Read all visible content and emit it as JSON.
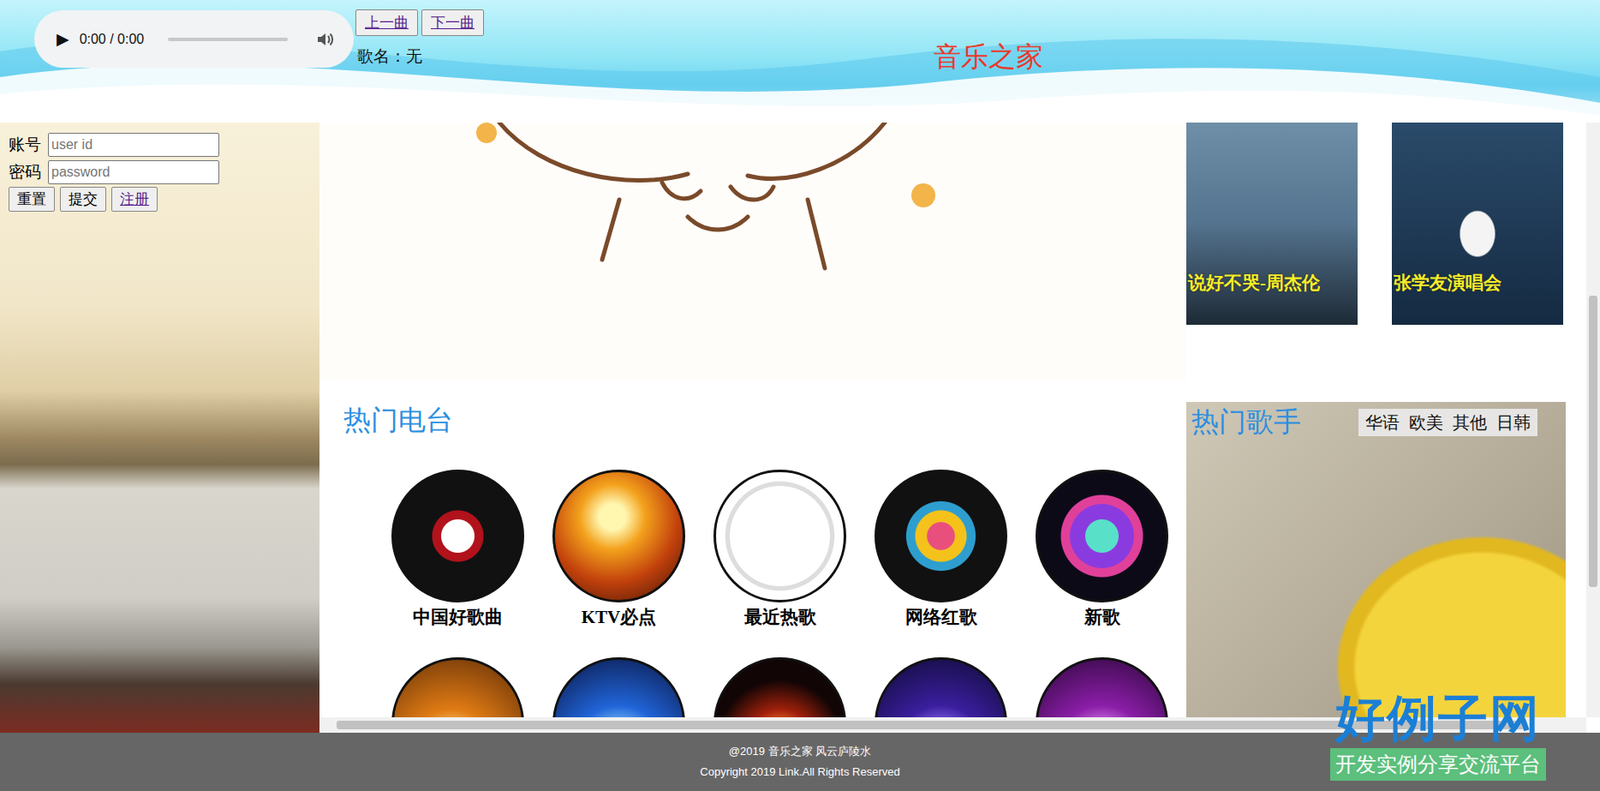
{
  "player": {
    "play_icon": "▶",
    "time": "0:00 / 0:00",
    "level": 0
  },
  "controls": [
    {
      "label": "上一曲"
    },
    {
      "label": "下一曲"
    }
  ],
  "song": "歌名：无",
  "site_title": "音乐之家",
  "login": {
    "fields": [
      {
        "label": "账号",
        "placeholder": "user id"
      },
      {
        "label": "密码",
        "placeholder": "password"
      }
    ],
    "buttons": [
      "重置",
      "提交",
      "注册"
    ]
  },
  "featured": [
    {
      "caption": "说好不哭-周杰伦"
    },
    {
      "caption": "张学友演唱会"
    }
  ],
  "radio": {
    "title": "热门电台",
    "stations": [
      {
        "label": "中国好歌曲"
      },
      {
        "label": "KTV必点"
      },
      {
        "label": "最近热歌"
      },
      {
        "label": "网络红歌"
      },
      {
        "label": "新歌"
      },
      {
        "label": ""
      },
      {
        "label": ""
      },
      {
        "label": ""
      },
      {
        "label": ""
      },
      {
        "label": ""
      }
    ]
  },
  "singers": {
    "title": "热门歌手",
    "tabs": [
      {
        "label": "华语",
        "selected": false
      },
      {
        "label": "欧美",
        "selected": false
      },
      {
        "label": "其他",
        "selected": false
      },
      {
        "label": "日韩",
        "selected": false
      }
    ]
  },
  "footer": [
    "@2019 音乐之家 风云庐陵水",
    "Copyright 2019 Link.All Rights Reserved"
  ],
  "watermark": {
    "logo": "好例子网",
    "slogan": "开发实例分享交流平台"
  }
}
